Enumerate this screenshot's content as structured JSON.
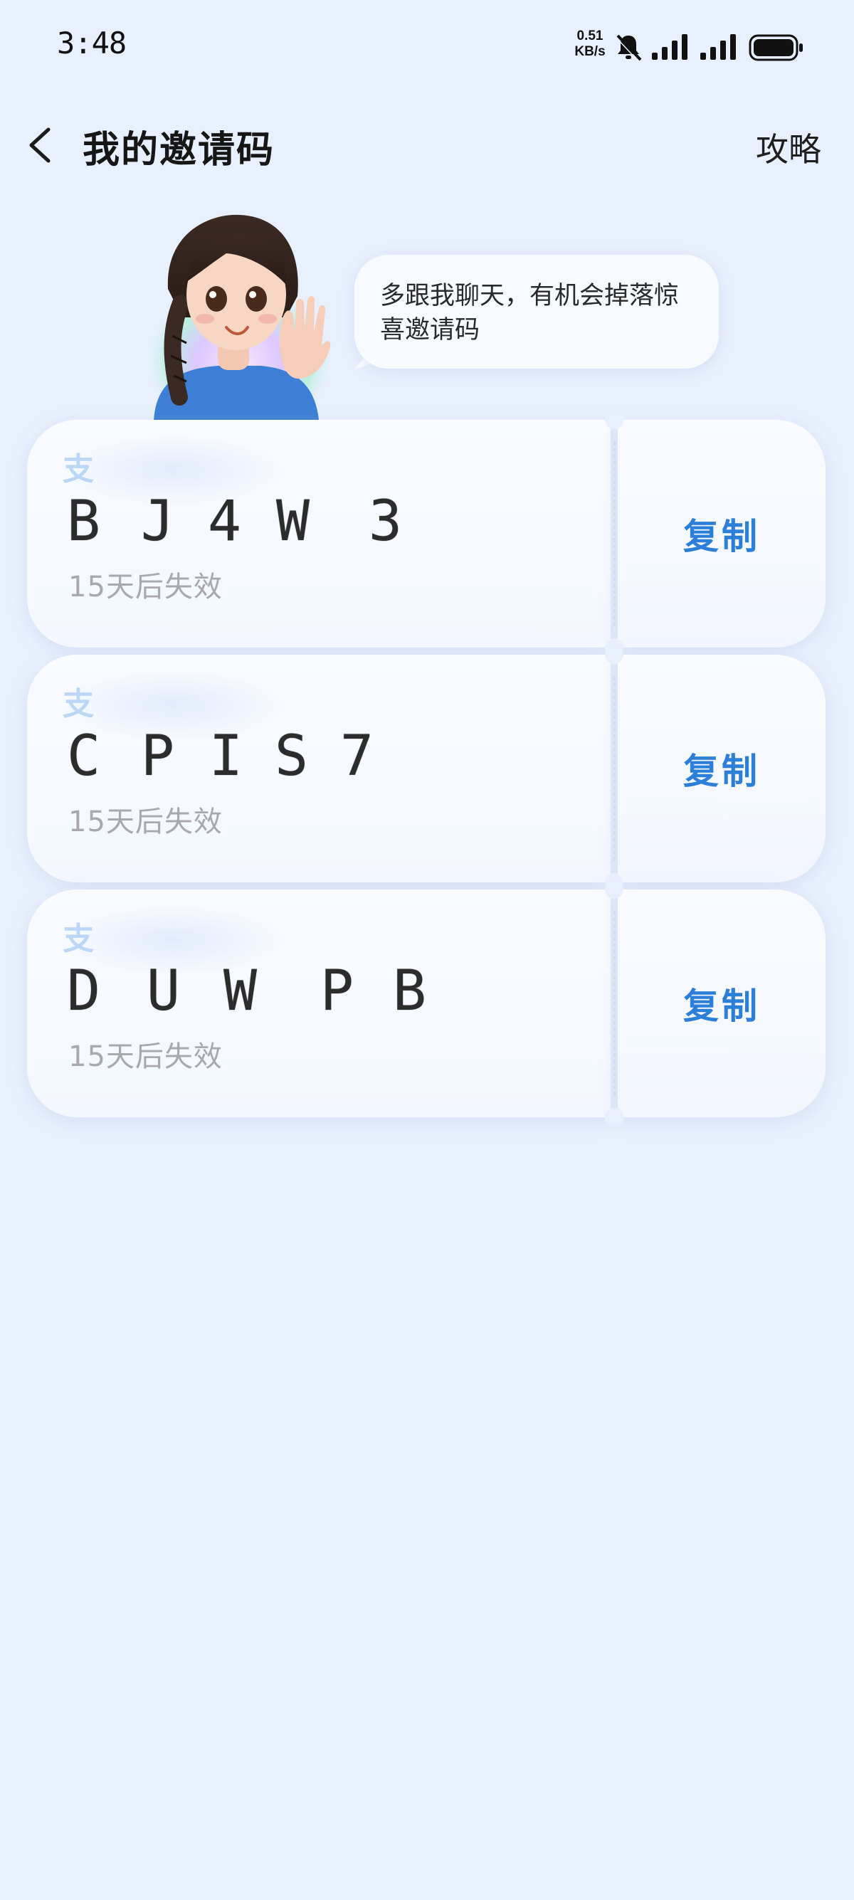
{
  "status_bar": {
    "time": "3:48",
    "net_speed_value": "0.51",
    "net_speed_unit": "KB/s",
    "icons": [
      "mute-icon",
      "signal-icon",
      "signal-icon",
      "battery-icon"
    ]
  },
  "header": {
    "title": "我的邀请码",
    "right_link": "攻略",
    "back_icon": "chevron-left-icon"
  },
  "assistant": {
    "bubble_text": "多跟我聊天，有机会掉落惊喜邀请码"
  },
  "cards": [
    {
      "watermark": "支",
      "code": [
        "B",
        "J",
        "4",
        "W",
        "3"
      ],
      "expire": "15天后失效",
      "copy_label": "复制"
    },
    {
      "watermark": "支",
      "code": [
        "C",
        "P",
        "I",
        "S",
        "7"
      ],
      "expire": "15天后失效",
      "copy_label": "复制"
    },
    {
      "watermark": "支",
      "code": [
        "D",
        "U",
        "W",
        "P",
        "B"
      ],
      "expire": "15天后失效",
      "copy_label": "复制"
    }
  ],
  "colors": {
    "background": "#e9f0fd",
    "accent": "#2b7fd9",
    "muted_text": "#a8a8ad"
  }
}
